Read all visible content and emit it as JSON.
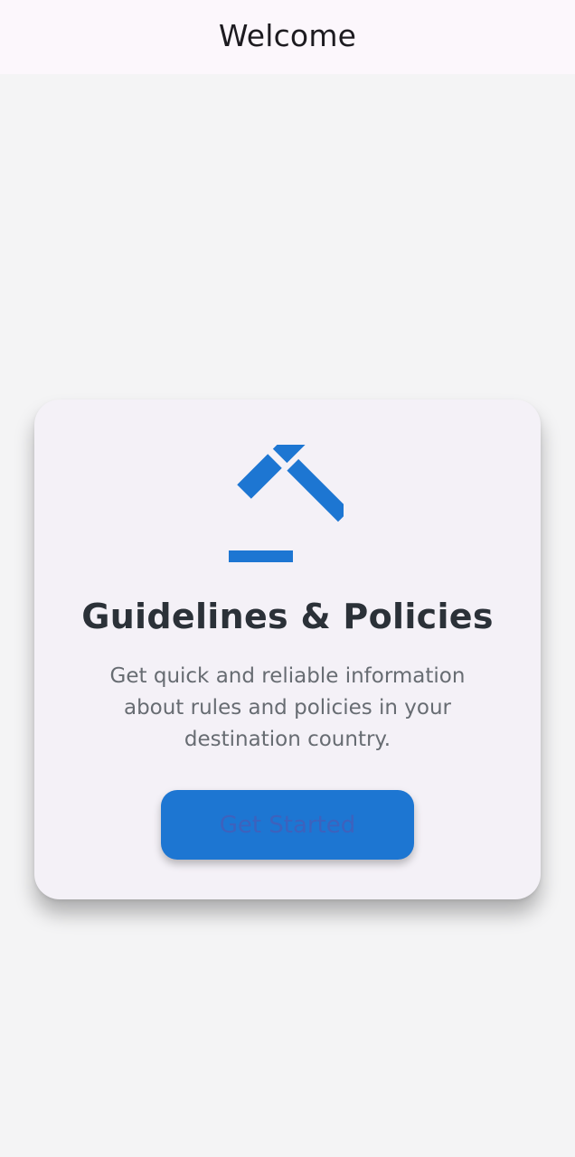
{
  "app_bar": {
    "title": "Welcome"
  },
  "card": {
    "icon": "gavel-icon",
    "title": "Guidelines & Policies",
    "description": "Get quick and reliable information about rules and policies in your destination country.",
    "button_label": "Get Started"
  },
  "colors": {
    "background": "#f4f4f5",
    "app_bar": "#fcf7fc",
    "card": "#f4f1f7",
    "accent": "#1d76d2",
    "title_text": "#2b3138",
    "body_text": "#676c72",
    "button_text": "#3d62bd"
  }
}
